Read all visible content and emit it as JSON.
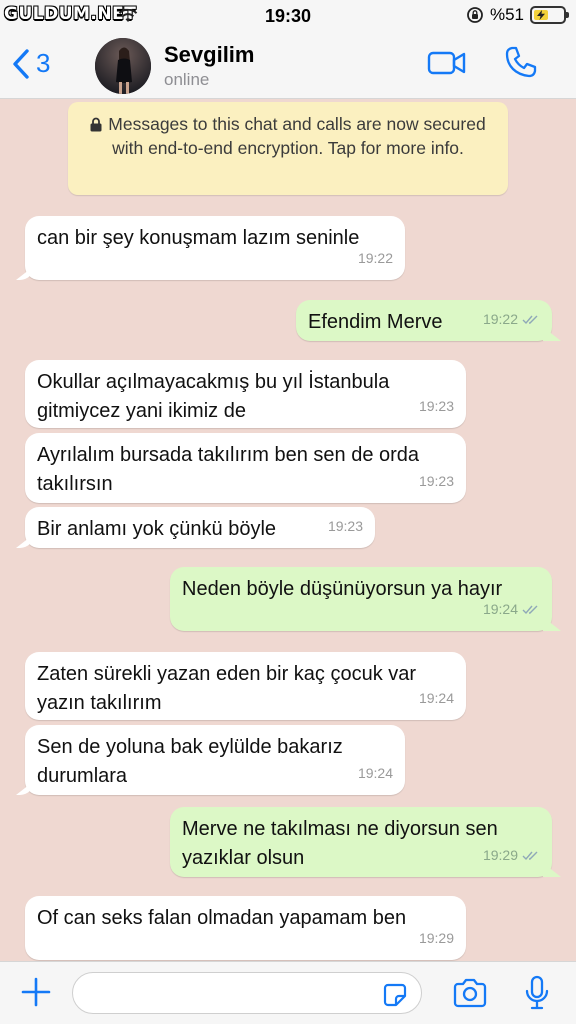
{
  "status": {
    "watermark": "GULDUM.NET",
    "time": "19:30",
    "battery": "%51",
    "battery_level": 0.51
  },
  "header": {
    "back_count": "3",
    "contact_name": "Sevgilim",
    "contact_status": "online"
  },
  "banner": {
    "text": "Messages to this chat and calls are now secured with end-to-end encryption. Tap for more info."
  },
  "messages": [
    {
      "dir": "in",
      "text": "can bir şey konuşmam lazım seninle",
      "time": "19:22"
    },
    {
      "dir": "out",
      "text": "Efendim Merve",
      "time": "19:22"
    },
    {
      "dir": "in",
      "text": "Okullar açılmayacakmış bu yıl İstanbula gitmiycez yani ikimiz de",
      "time": "19:23"
    },
    {
      "dir": "in",
      "text": "Ayrılalım bursada takılırım ben sen de orda takılırsın",
      "time": "19:23"
    },
    {
      "dir": "in",
      "text": "Bir anlamı yok çünkü böyle",
      "time": "19:23"
    },
    {
      "dir": "out",
      "text": "Neden böyle düşünüyorsun ya hayır",
      "time": "19:24"
    },
    {
      "dir": "in",
      "text": "Zaten sürekli yazan eden bir kaç çocuk var yazın takılırım",
      "time": "19:24"
    },
    {
      "dir": "in",
      "text": "Sen de yoluna bak eylülde bakarız durumlara",
      "time": "19:24"
    },
    {
      "dir": "out",
      "text": "Merve ne takılması ne diyorsun sen yazıklar olsun",
      "time": "19:29"
    },
    {
      "dir": "in",
      "text": "Of can seks falan olmadan yapamam ben",
      "time": "19:29"
    }
  ],
  "input": {
    "placeholder": ""
  },
  "colors": {
    "chat_background": "#efd8d1",
    "incoming_bubble": "#ffffff",
    "outgoing_bubble": "#dcf8c6",
    "accent": "#1479f6",
    "banner": "#fbf0c0"
  }
}
